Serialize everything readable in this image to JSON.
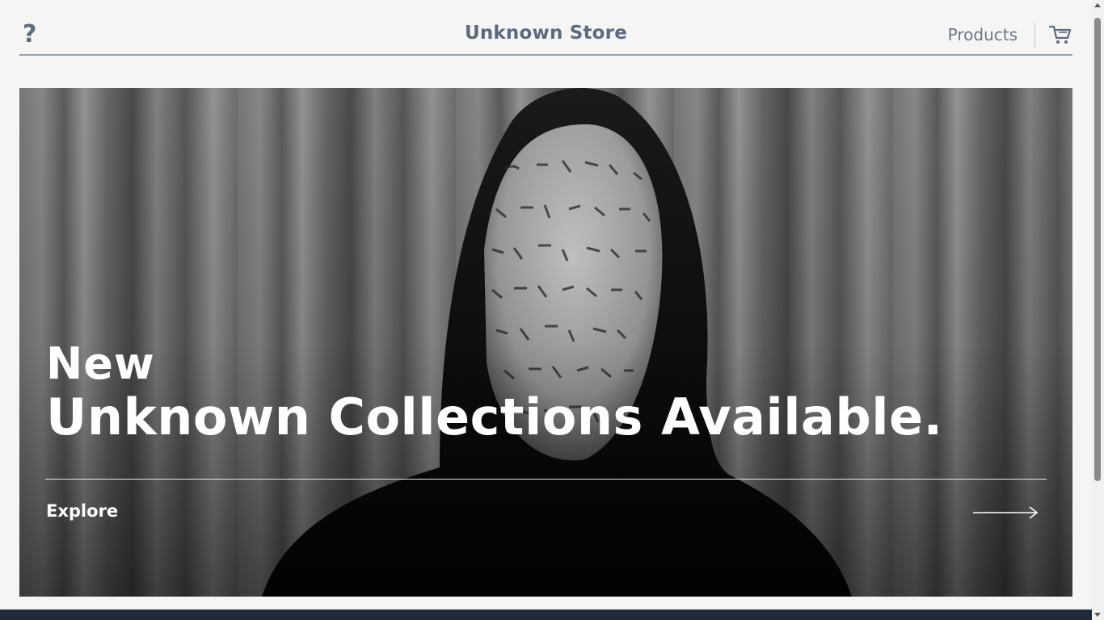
{
  "header": {
    "help_icon": "question-mark-icon",
    "help_symbol": "?",
    "brand": "Unknown Store",
    "nav": {
      "products": "Products"
    },
    "cart_icon": "cart-icon"
  },
  "hero": {
    "kicker": "New",
    "title": "Unknown Collections Available.",
    "cta": "Explore",
    "cta_icon": "arrow-right-icon",
    "image": "hooded-figure-with-wrapped-face-photo"
  },
  "colors": {
    "brand_text": "#5c6a80",
    "nav_text": "#6b7689",
    "header_rule": "#9aa1b0",
    "hero_text": "#ffffff",
    "footer": "#1f2a3a"
  }
}
